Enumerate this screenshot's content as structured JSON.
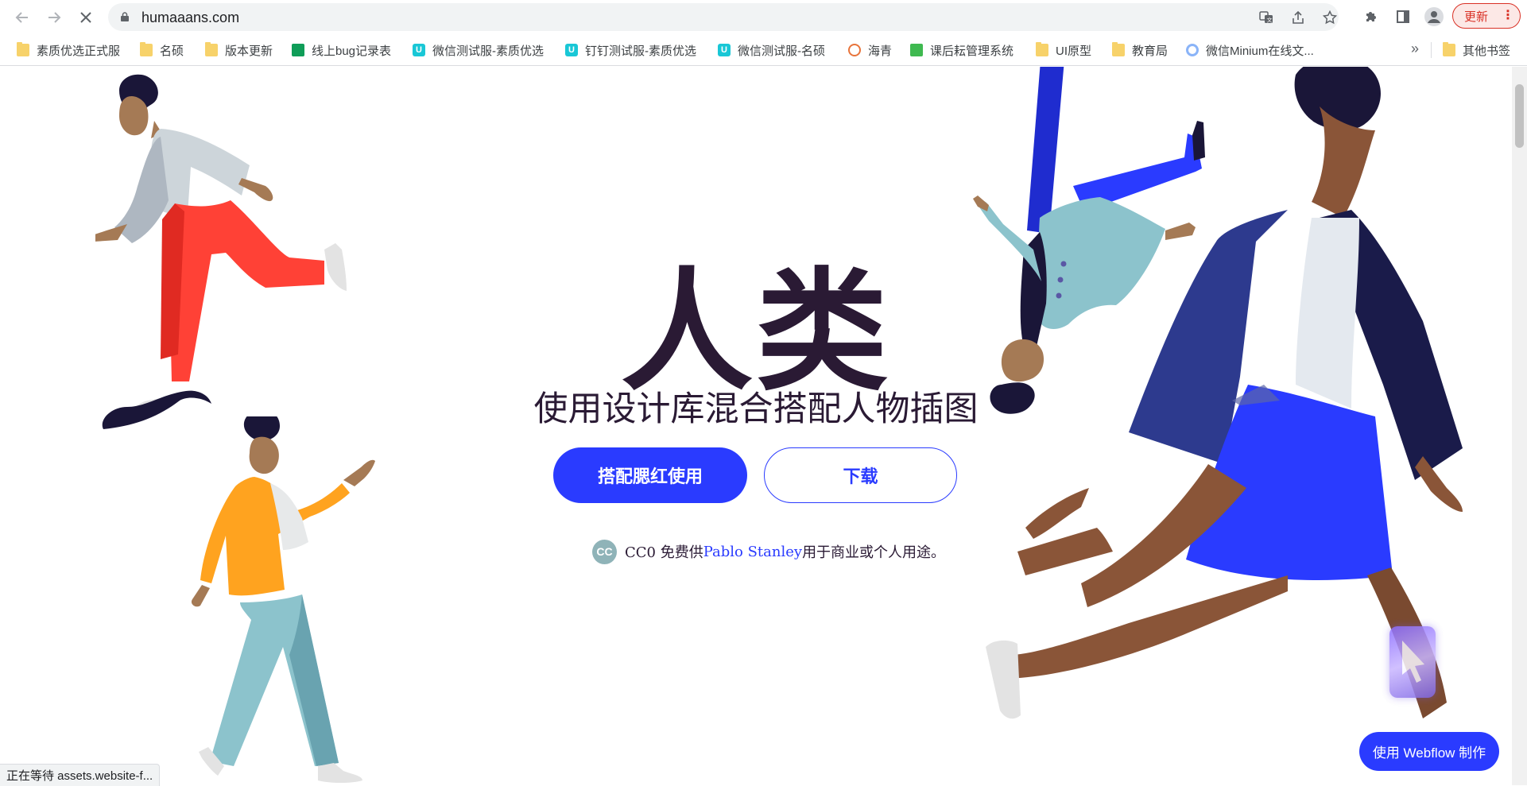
{
  "browser": {
    "url": "humaaans.com",
    "update_label": "更新",
    "more_bookmarks_label": "»"
  },
  "bookmarks": [
    {
      "label": "素质优选正式服",
      "icon": "folder"
    },
    {
      "label": "名硕",
      "icon": "folder"
    },
    {
      "label": "版本更新",
      "icon": "folder"
    },
    {
      "label": "线上bug记录表",
      "icon": "sheet"
    },
    {
      "label": "微信测试服-素质优选",
      "icon": "uni-app"
    },
    {
      "label": "钉钉测试服-素质优选",
      "icon": "uni-app"
    },
    {
      "label": "微信测试服-名硕",
      "icon": "uni-app"
    },
    {
      "label": "海青",
      "icon": "circle"
    },
    {
      "label": "课后耘管理系统",
      "icon": "green-app"
    },
    {
      "label": "UI原型",
      "icon": "folder"
    },
    {
      "label": "教育局",
      "icon": "folder"
    },
    {
      "label": "微信Minium在线文...",
      "icon": "ring"
    },
    {
      "label": "其他书签",
      "icon": "folder"
    }
  ],
  "hero": {
    "title": "人类",
    "subtitle": "使用设计库混合搭配人物插图",
    "primary_button": "搭配腮红使用",
    "secondary_button": "下载",
    "license_prefix": "CC0 免费供",
    "license_link": "Pablo Stanley",
    "license_suffix": "用于商业或个人用途。",
    "cc_badge": "CC"
  },
  "webflow_badge": "使用 Webflow 制作",
  "status_text": "正在等待 assets.website-f...",
  "colors": {
    "accent": "#2a3bff",
    "title": "#2a1a34"
  }
}
